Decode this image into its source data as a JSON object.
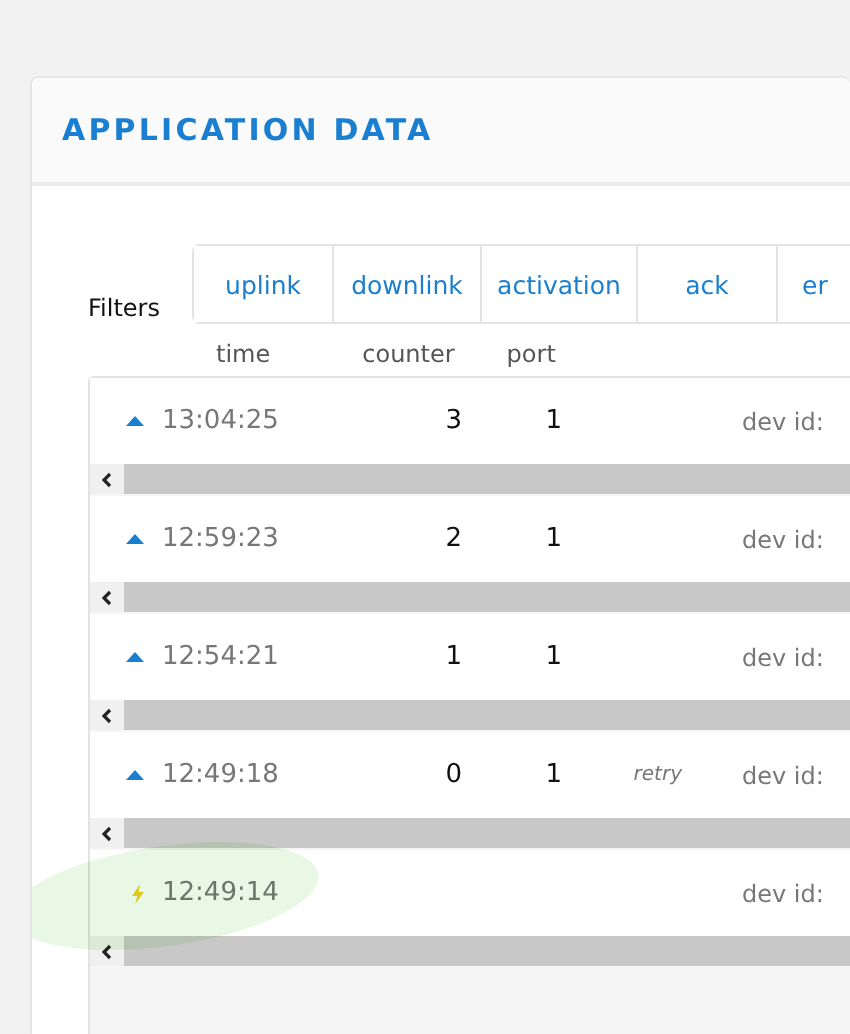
{
  "title": "APPLICATION DATA",
  "filters": {
    "label": "Filters",
    "tabs": [
      {
        "label": "uplink",
        "selected": false
      },
      {
        "label": "downlink",
        "selected": false
      },
      {
        "label": "activation",
        "selected": false
      },
      {
        "label": "ack",
        "selected": false
      },
      {
        "label": "er",
        "selected": false
      }
    ]
  },
  "columns": [
    "time",
    "counter",
    "port"
  ],
  "rows": [
    {
      "kind": "uplink",
      "time": "13:04:25",
      "counter": "3",
      "port": "1",
      "dev_label": "dev id:",
      "highlighted": false
    },
    {
      "kind": "uplink",
      "time": "12:59:23",
      "counter": "2",
      "port": "1",
      "dev_label": "dev id:",
      "highlighted": false
    },
    {
      "kind": "uplink",
      "time": "12:54:21",
      "counter": "1",
      "port": "1",
      "dev_label": "dev id:",
      "highlighted": false
    },
    {
      "kind": "uplink",
      "time": "12:49:18",
      "counter": "0",
      "port": "1",
      "note": "retry",
      "dev_label": "dev id:",
      "highlighted": false
    },
    {
      "kind": "activation",
      "time": "12:49:14",
      "dev_label": "dev id:",
      "highlighted": true
    }
  ]
}
